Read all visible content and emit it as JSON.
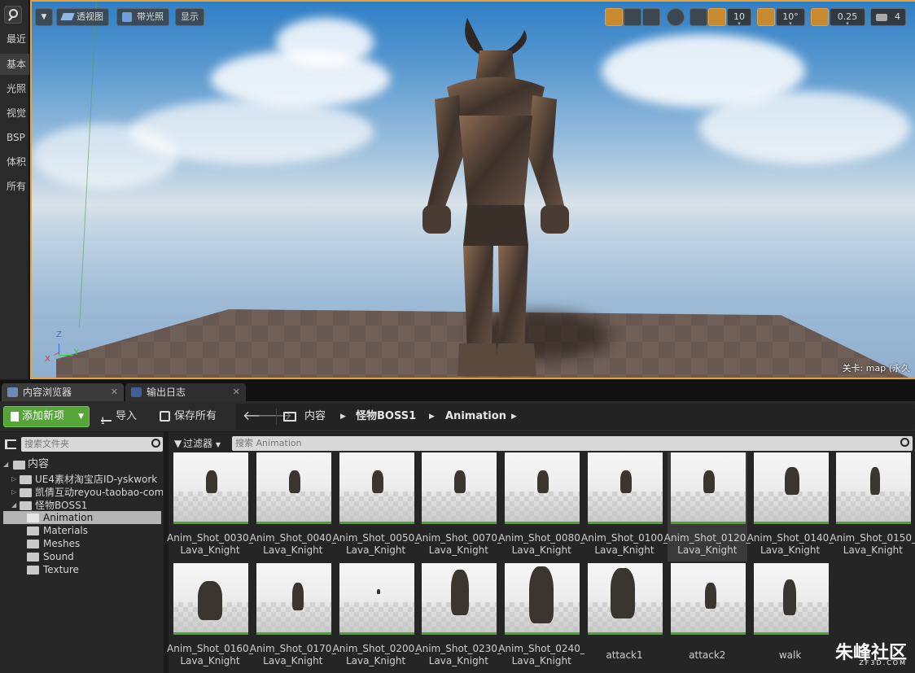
{
  "modes": {
    "items": [
      "最近",
      "基本",
      "光照",
      "视觉",
      "BSP",
      "体积",
      "所有"
    ],
    "active_index": 1
  },
  "viewport": {
    "view_mode": "透视图",
    "lighting_mode": "带光照",
    "show_label": "显示",
    "grid_snap": "10",
    "rotation_snap": "10°",
    "scale_snap": "0.25",
    "camera_speed": "4",
    "level_label": "关卡: map (永久"
  },
  "tabs": [
    {
      "label": "内容浏览器",
      "active": true
    },
    {
      "label": "输出日志",
      "active": false
    }
  ],
  "toolbar": {
    "add_new": "添加新项",
    "import": "导入",
    "save_all": "保存所有"
  },
  "breadcrumb": [
    "内容",
    "怪物BOSS1",
    "Animation"
  ],
  "tree": {
    "search_placeholder": "搜索文件夹",
    "root": "内容",
    "folders": [
      {
        "label": "UE4素材淘宝店ID-yskwork",
        "level": 1,
        "expanded": false
      },
      {
        "label": "凯倩互动reyou-taobao-com",
        "level": 1,
        "expanded": false
      },
      {
        "label": "怪物BOSS1",
        "level": 1,
        "expanded": true
      },
      {
        "label": "Animation",
        "level": 2,
        "selected": true
      },
      {
        "label": "Materials",
        "level": 2
      },
      {
        "label": "Meshes",
        "level": 2
      },
      {
        "label": "Sound",
        "level": 2
      },
      {
        "label": "Texture",
        "level": 2
      }
    ]
  },
  "assets": {
    "filter_label": "过滤器",
    "search_placeholder": "搜索 Animation",
    "items": [
      [
        "Anim_Shot_0030_",
        "Lava_Knight"
      ],
      [
        "Anim_Shot_0040_",
        "Lava_Knight"
      ],
      [
        "Anim_Shot_0050_",
        "Lava_Knight"
      ],
      [
        "Anim_Shot_0070_",
        "Lava_Knight"
      ],
      [
        "Anim_Shot_0080_",
        "Lava_Knight"
      ],
      [
        "Anim_Shot_0100_",
        "Lava_Knight"
      ],
      [
        "Anim_Shot_0120_",
        "Lava_Knight"
      ],
      [
        "Anim_Shot_0140_",
        "Lava_Knight"
      ],
      [
        "Anim_Shot_0150_",
        "Lava_Knight"
      ],
      [
        "Anim_Shot_0160_",
        "Lava_Knight"
      ],
      [
        "Anim_Shot_0170_",
        "Lava_Knight"
      ],
      [
        "Anim_Shot_0200_",
        "Lava_Knight"
      ],
      [
        "Anim_Shot_0230_",
        "Lava_Knight"
      ],
      [
        "Anim_Shot_0240_",
        "Lava_Knight"
      ],
      [
        "attack1",
        ""
      ],
      [
        "attack2",
        ""
      ],
      [
        "walk",
        ""
      ]
    ],
    "selected_index": 6
  },
  "watermark": {
    "title": "朱峰社区",
    "sub": "ZF3D.COM"
  },
  "colors": {
    "accent_orange": "#e8a23a",
    "add_green": "#55a538",
    "asset_underline": "#4aa52e"
  }
}
